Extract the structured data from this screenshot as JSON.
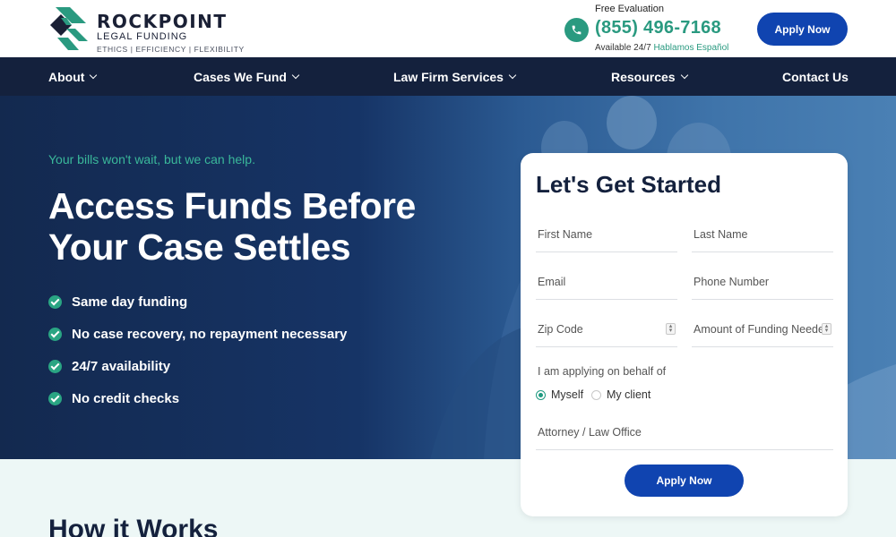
{
  "brand": {
    "name": "ROCKPOINT",
    "subname": "LEGAL FUNDING",
    "tagline": "ETHICS  |  EFFICIENCY  |  FLEXIBILITY",
    "colors": {
      "navy": "#14213d",
      "teal": "#2a9a80",
      "blue": "#1044b0"
    }
  },
  "header": {
    "free_eval": "Free Evaluation",
    "phone": "(855) 496-7168",
    "availability": "Available 24/7",
    "spanish": "Hablamos Español",
    "phone_icon": "phone-icon",
    "apply_label": "Apply Now"
  },
  "nav": {
    "items": [
      {
        "label": "About",
        "dropdown": true
      },
      {
        "label": "Cases We Fund",
        "dropdown": true
      },
      {
        "label": "Law Firm Services",
        "dropdown": true
      },
      {
        "label": "Resources",
        "dropdown": true
      },
      {
        "label": "Contact Us",
        "dropdown": false
      }
    ]
  },
  "hero": {
    "tagline": "Your bills won't wait, but we can help.",
    "title": "Access Funds Before Your Case Settles",
    "features": [
      "Same day funding",
      "No case recovery, no repayment necessary",
      "24/7 availability",
      "No credit checks"
    ]
  },
  "form": {
    "title": "Let's Get Started",
    "first_name": "First Name",
    "last_name": "Last Name",
    "email": "Email",
    "phone": "Phone Number",
    "zip": "Zip Code",
    "amount": "Amount of Funding Needed",
    "behalf_label": "I am applying on behalf of",
    "option_myself": "Myself",
    "option_client": "My client",
    "selected_option": "Myself",
    "attorney": "Attorney / Law Office",
    "submit_label": "Apply Now"
  },
  "section": {
    "how_title": "How it Works"
  }
}
